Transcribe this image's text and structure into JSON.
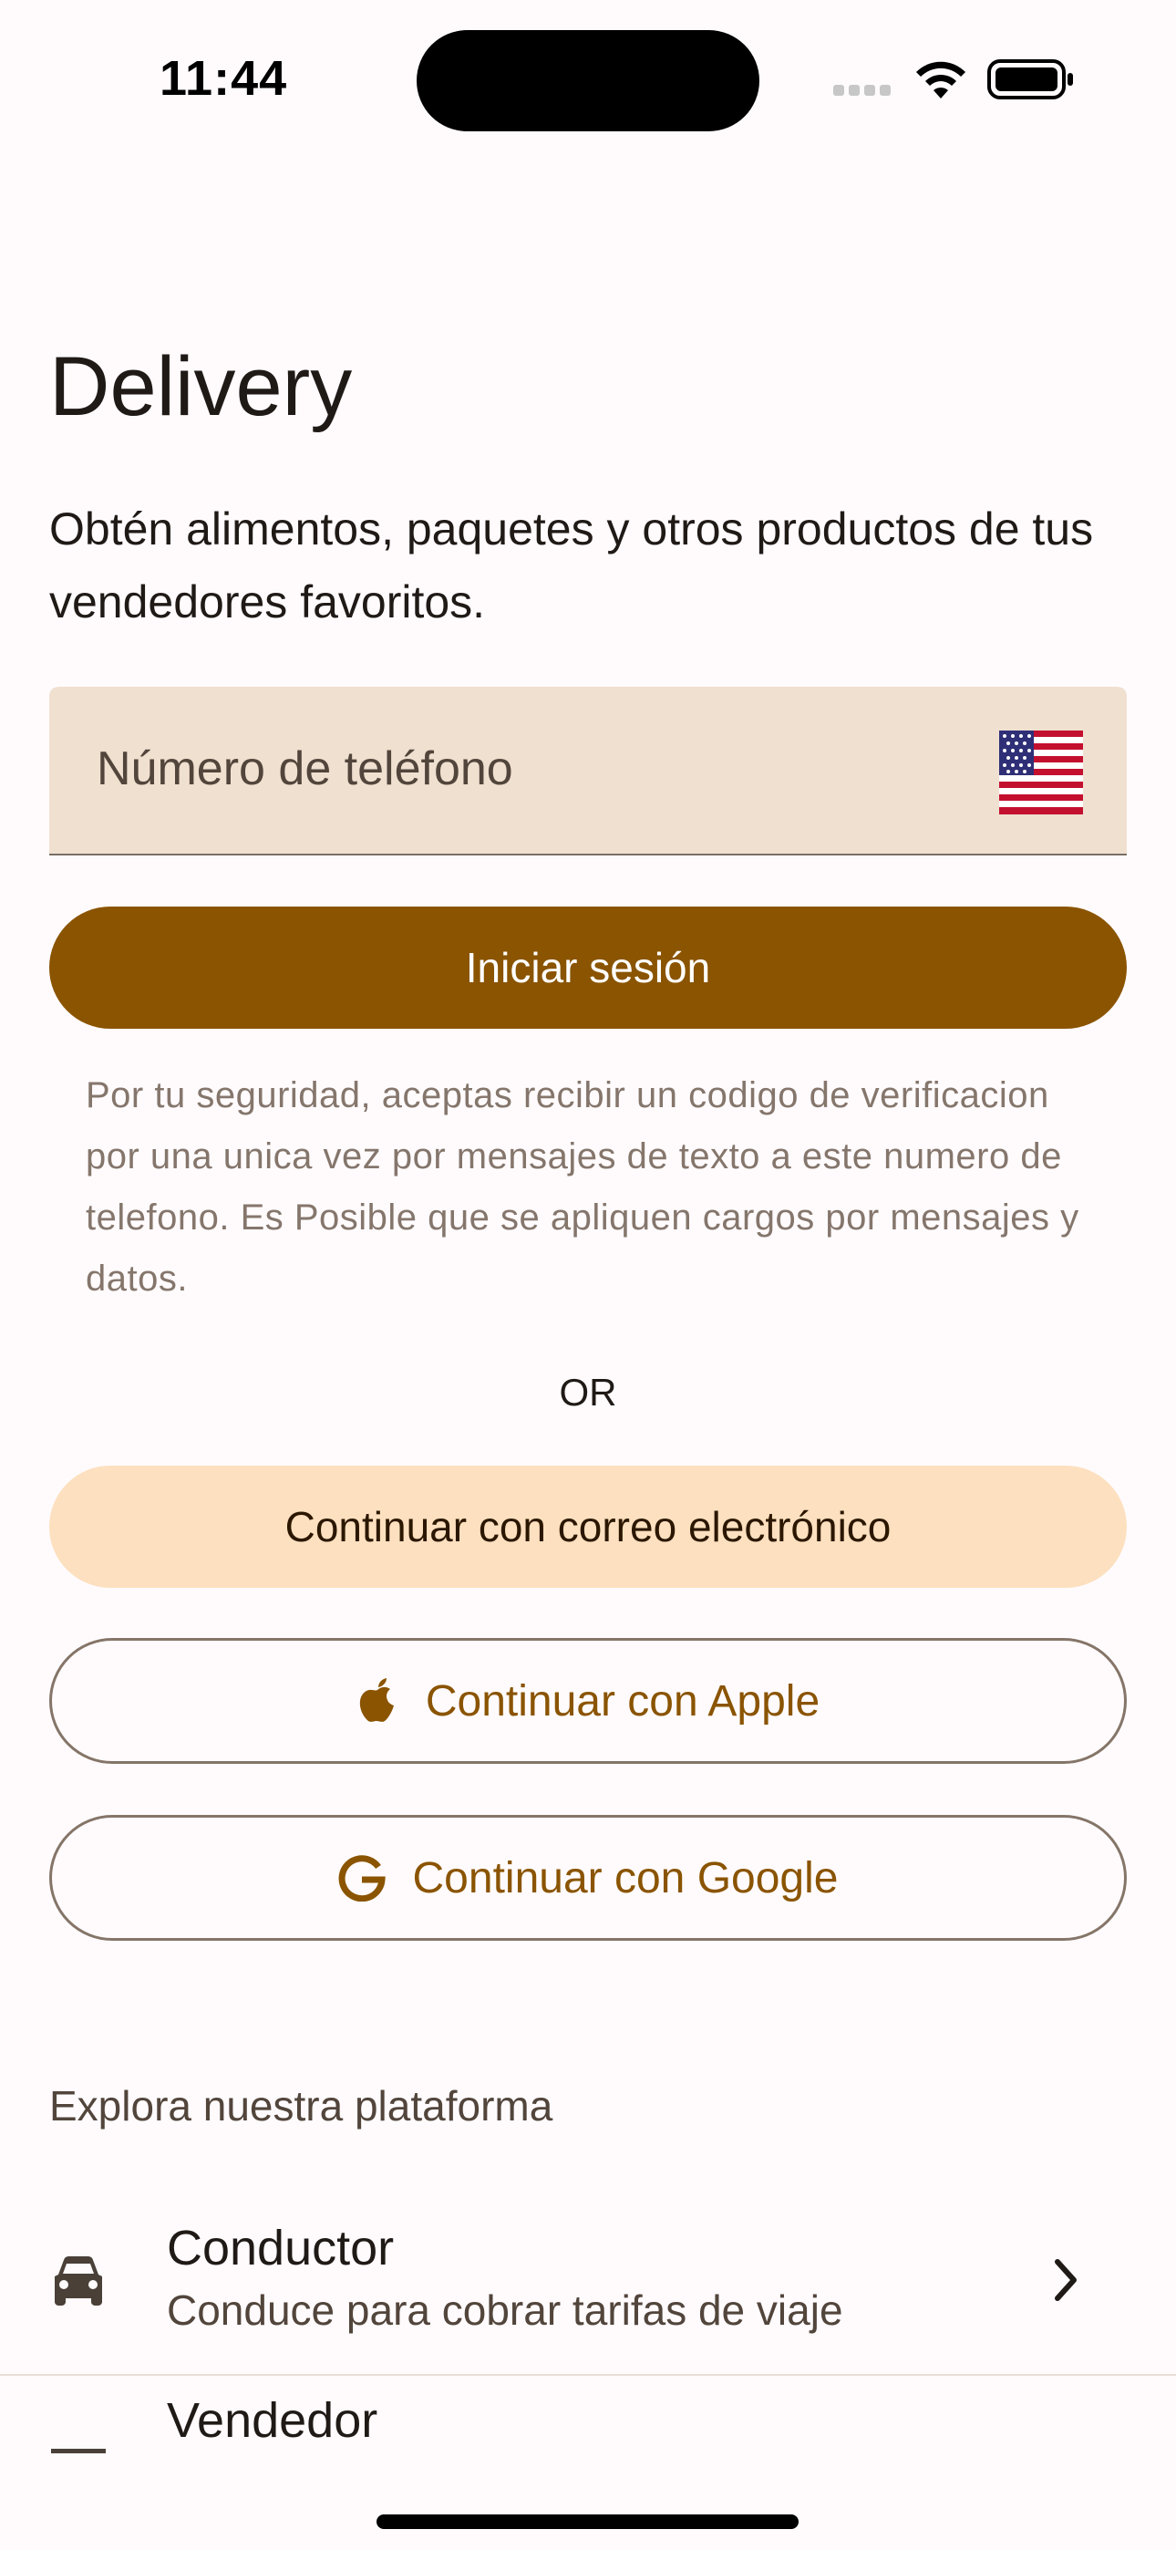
{
  "status_bar": {
    "time": "11:44"
  },
  "header": {
    "title": "Delivery",
    "subtitle": "Obtén alimentos, paquetes y otros productos de tus vendedores favoritos."
  },
  "phone": {
    "placeholder": "Número de teléfono",
    "country_flag": "us-flag-icon"
  },
  "actions": {
    "sign_in_label": "Iniciar sesión",
    "disclaimer": "Por tu seguridad, aceptas recibir un codigo de verificacion por una unica vez por mensajes de texto a este numero de telefono. Es Posible que se apliquen cargos por mensajes y datos.",
    "or_label": "OR",
    "email_label": "Continuar con correo electrónico",
    "apple_label": "Continuar con Apple",
    "google_label": "Continuar con Google"
  },
  "explore": {
    "heading": "Explora nuestra plataforma",
    "items": [
      {
        "title": "Conductor",
        "description": "Conduce para cobrar tarifas de viaje",
        "icon": "car-icon"
      },
      {
        "title": "Vendedor",
        "description": "",
        "icon": "store-icon"
      }
    ]
  },
  "colors": {
    "primary": "#8a5400",
    "field_bg": "#f0e0d0",
    "secondary_container": "#fde0bf",
    "background": "#fffbfd"
  }
}
